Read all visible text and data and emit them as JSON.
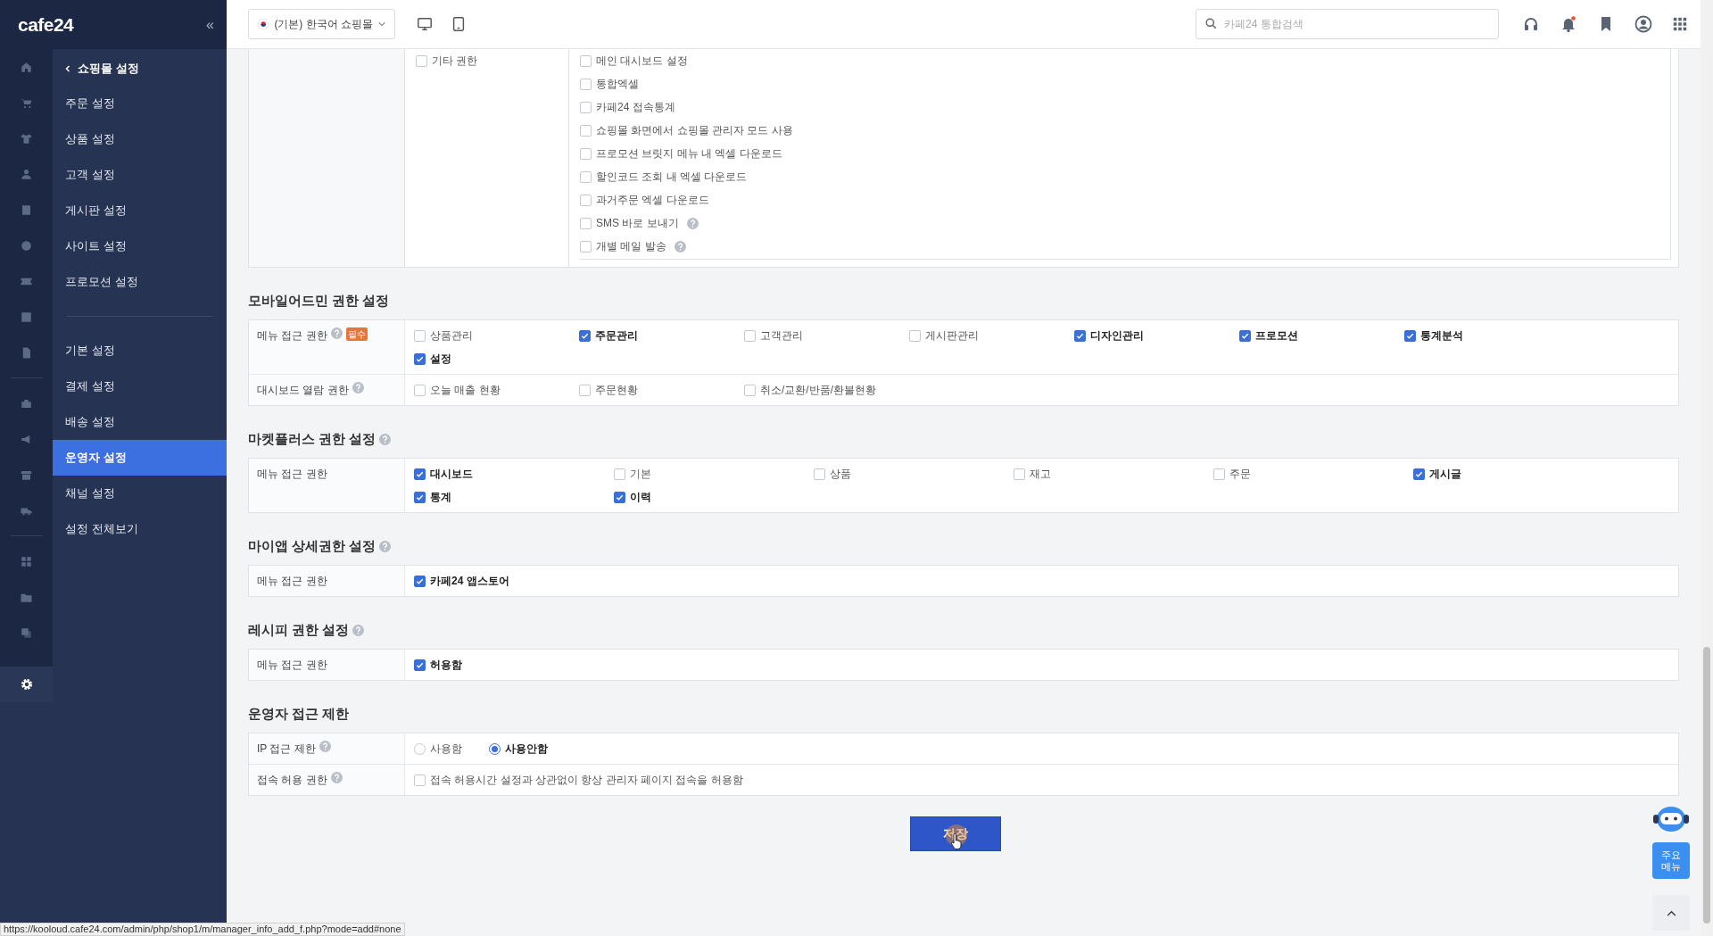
{
  "sidebar": {
    "logo": "cafe24",
    "collapse": "«",
    "back": "쇼핑몰 설정",
    "groups": [
      [
        {
          "label": "주문 설정",
          "selected": false
        },
        {
          "label": "상품 설정",
          "selected": false
        },
        {
          "label": "고객 설정",
          "selected": false
        },
        {
          "label": "게시판 설정",
          "selected": false
        },
        {
          "label": "사이트 설정",
          "selected": false
        },
        {
          "label": "프로모션 설정",
          "selected": false
        }
      ],
      [
        {
          "label": "기본 설정",
          "selected": false
        },
        {
          "label": "결제 설정",
          "selected": false
        },
        {
          "label": "배송 설정",
          "selected": false
        },
        {
          "label": "운영자 설정",
          "selected": true
        },
        {
          "label": "채널 설정",
          "selected": false
        },
        {
          "label": "설정 전체보기",
          "selected": false
        }
      ]
    ]
  },
  "topbar": {
    "shop_select": "(기본) 한국어 쇼핑몰",
    "search": {
      "placeholder": "카페24 통합검색"
    }
  },
  "other_permissions": {
    "group": {
      "label": "기타 권한",
      "checked": false
    },
    "items": [
      {
        "label": "메인 대시보드 설정",
        "checked": false,
        "help": false
      },
      {
        "label": "통합엑셀",
        "checked": false,
        "help": false
      },
      {
        "label": "카페24 접속통계",
        "checked": false,
        "help": false
      },
      {
        "label": "쇼핑몰 화면에서 쇼핑몰 관리자 모드 사용",
        "checked": false,
        "help": false
      },
      {
        "label": "프로모션 브릿지 메뉴 내 엑셀 다운로드",
        "checked": false,
        "help": false
      },
      {
        "label": "할인코드 조회 내 엑셀 다운로드",
        "checked": false,
        "help": false
      },
      {
        "label": "과거주문 엑셀 다운로드",
        "checked": false,
        "help": false
      },
      {
        "label": "SMS 바로 보내기",
        "checked": false,
        "help": true
      },
      {
        "label": "개별 메일 발송",
        "checked": false,
        "help": true
      }
    ]
  },
  "sections": [
    {
      "kind": "seven",
      "title": "모바일어드민 권한 설정",
      "help": false,
      "rows": [
        {
          "label": "메뉴 접근 권한",
          "help": true,
          "badge": "필수",
          "kind": "checkbox",
          "options": [
            {
              "label": "상품관리",
              "checked": false
            },
            {
              "label": "주문관리",
              "checked": true
            },
            {
              "label": "고객관리",
              "checked": false
            },
            {
              "label": "게시판관리",
              "checked": false
            },
            {
              "label": "디자인관리",
              "checked": true
            },
            {
              "label": "프로모션",
              "checked": true
            },
            {
              "label": "통계분석",
              "checked": true
            },
            {
              "label": "설정",
              "checked": true
            }
          ]
        },
        {
          "label": "대시보드 열람 권한",
          "help": true,
          "kind": "checkbox",
          "options": [
            {
              "label": "오늘 매출 현황",
              "checked": false
            },
            {
              "label": "주문현황",
              "checked": false
            },
            {
              "label": "취소/교환/반품/환불현황",
              "checked": false
            }
          ]
        }
      ]
    },
    {
      "kind": "six",
      "title": "마켓플러스 권한 설정",
      "help": true,
      "rows": [
        {
          "label": "메뉴 접근 권한",
          "help": false,
          "kind": "checkbox",
          "options": [
            {
              "label": "대시보드",
              "checked": true
            },
            {
              "label": "기본",
              "checked": false
            },
            {
              "label": "상품",
              "checked": false
            },
            {
              "label": "재고",
              "checked": false
            },
            {
              "label": "주문",
              "checked": false
            },
            {
              "label": "게시글",
              "checked": true
            },
            {
              "label": "통계",
              "checked": true
            },
            {
              "label": "이력",
              "checked": true
            }
          ]
        }
      ]
    },
    {
      "kind": "six",
      "title": "마이앱 상세권한 설정",
      "help": true,
      "rows": [
        {
          "label": "메뉴 접근 권한",
          "help": false,
          "kind": "checkbox",
          "options": [
            {
              "label": "카페24 앱스토어",
              "checked": true
            }
          ]
        }
      ]
    },
    {
      "kind": "six",
      "title": "레시피 권한 설정",
      "help": true,
      "rows": [
        {
          "label": "메뉴 접근 권한",
          "help": false,
          "kind": "checkbox",
          "options": [
            {
              "label": "허용함",
              "checked": true
            }
          ]
        }
      ]
    },
    {
      "kind": "inline",
      "title": "운영자 접근 제한",
      "help": false,
      "rows": [
        {
          "label": "IP 접근 제한",
          "help": true,
          "kind": "radio",
          "options": [
            {
              "label": "사용함",
              "selected": false
            },
            {
              "label": "사용안함",
              "selected": true
            }
          ]
        },
        {
          "label": "접속 허용 권한",
          "help": true,
          "kind": "checkbox",
          "options": [
            {
              "label": "접속 허용시간 설정과 상관없이 항상 관리자 페이지 접속을 허용함",
              "checked": false
            }
          ]
        }
      ]
    }
  ],
  "save_button": "저장",
  "main_menu_button": "주요 메뉴",
  "status_url": "https://kooloud.cafe24.com/admin/php/shop1/m/manager_info_add_f.php?mode=add#none"
}
